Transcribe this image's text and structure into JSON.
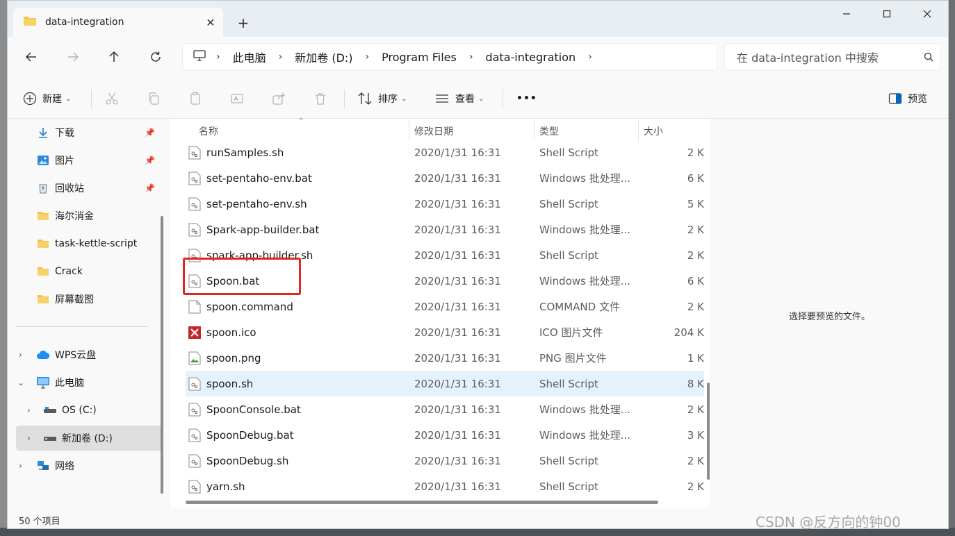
{
  "window": {
    "tab_title": "data-integration",
    "tab_close": "✕",
    "new_tab": "+"
  },
  "nav": {
    "breadcrumb": [
      "此电脑",
      "新加卷 (D:)",
      "Program Files",
      "data-integration"
    ],
    "search_placeholder": "在 data-integration 中搜索"
  },
  "commands": {
    "new_label": "新建",
    "sort_label": "排序",
    "view_label": "查看",
    "more_label": "•••",
    "preview_label": "预览"
  },
  "sidebar": {
    "items": [
      {
        "label": "下载",
        "icon": "download-icon",
        "pinned": true
      },
      {
        "label": "图片",
        "icon": "pictures-icon",
        "pinned": true
      },
      {
        "label": "回收站",
        "icon": "recycle-bin-icon",
        "pinned": true
      },
      {
        "label": "海尔消金",
        "icon": "folder-icon",
        "pinned": false
      },
      {
        "label": "task-kettle-script",
        "icon": "folder-icon",
        "pinned": false
      },
      {
        "label": "Crack",
        "icon": "folder-icon",
        "pinned": false
      },
      {
        "label": "屏幕截图",
        "icon": "folder-icon",
        "pinned": false
      },
      {
        "label": "WPS云盘",
        "icon": "cloud-icon",
        "pinned": false
      },
      {
        "label": "此电脑",
        "icon": "computer-icon",
        "pinned": false
      },
      {
        "label": "OS (C:)",
        "icon": "drive-icon",
        "pinned": false
      },
      {
        "label": "新加卷 (D:)",
        "icon": "drive-icon",
        "pinned": false,
        "active": true
      },
      {
        "label": "网络",
        "icon": "network-icon",
        "pinned": false
      }
    ]
  },
  "columns": {
    "name": "名称",
    "date": "修改日期",
    "type": "类型",
    "size": "大小"
  },
  "files": [
    {
      "name": "runSamples.sh",
      "date": "2020/1/31 16:31",
      "type": "Shell Script",
      "size": "2 K",
      "icon": "script"
    },
    {
      "name": "set-pentaho-env.bat",
      "date": "2020/1/31 16:31",
      "type": "Windows 批处理...",
      "size": "6 K",
      "icon": "script"
    },
    {
      "name": "set-pentaho-env.sh",
      "date": "2020/1/31 16:31",
      "type": "Shell Script",
      "size": "5 K",
      "icon": "script"
    },
    {
      "name": "Spark-app-builder.bat",
      "date": "2020/1/31 16:31",
      "type": "Windows 批处理...",
      "size": "2 K",
      "icon": "script"
    },
    {
      "name": "spark-app-builder.sh",
      "date": "2020/1/31 16:31",
      "type": "Shell Script",
      "size": "2 K",
      "icon": "script"
    },
    {
      "name": "Spoon.bat",
      "date": "2020/1/31 16:31",
      "type": "Windows 批处理...",
      "size": "6 K",
      "icon": "script"
    },
    {
      "name": "spoon.command",
      "date": "2020/1/31 16:31",
      "type": "COMMAND 文件",
      "size": "2 K",
      "icon": "blank"
    },
    {
      "name": "spoon.ico",
      "date": "2020/1/31 16:31",
      "type": "ICO 图片文件",
      "size": "204 K",
      "icon": "ico"
    },
    {
      "name": "spoon.png",
      "date": "2020/1/31 16:31",
      "type": "PNG 图片文件",
      "size": "1 K",
      "icon": "png"
    },
    {
      "name": "spoon.sh",
      "date": "2020/1/31 16:31",
      "type": "Shell Script",
      "size": "8 K",
      "icon": "script",
      "selected": true
    },
    {
      "name": "SpoonConsole.bat",
      "date": "2020/1/31 16:31",
      "type": "Windows 批处理...",
      "size": "2 K",
      "icon": "script"
    },
    {
      "name": "SpoonDebug.bat",
      "date": "2020/1/31 16:31",
      "type": "Windows 批处理...",
      "size": "3 K",
      "icon": "script"
    },
    {
      "name": "SpoonDebug.sh",
      "date": "2020/1/31 16:31",
      "type": "Shell Script",
      "size": "2 K",
      "icon": "script"
    },
    {
      "name": "yarn.sh",
      "date": "2020/1/31 16:31",
      "type": "Shell Script",
      "size": "2 K",
      "icon": "script"
    }
  ],
  "preview": {
    "empty_text": "选择要预览的文件。"
  },
  "status": {
    "count": "50 个项目"
  },
  "watermark": "CSDN @反方向的钟00",
  "colors": {
    "accent": "#0067c0",
    "highlight_box": "#e0261f",
    "selected_row": "#e5f1fb",
    "folder": "#f3c14b"
  }
}
